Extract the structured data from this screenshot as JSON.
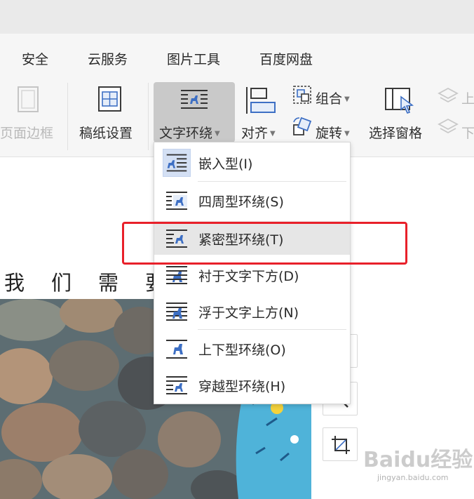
{
  "tabs": [
    "安全",
    "云服务",
    "图片工具",
    "百度网盘"
  ],
  "ribbon": {
    "page_border": "页面边框",
    "grid_setting": "稿纸设置",
    "text_wrap": "文字环绕",
    "align": "对齐",
    "group": "组合",
    "rotate": "旋转",
    "selection_pane": "选择窗格",
    "bring_forward": "上",
    "send_backward": "下"
  },
  "menu": {
    "items": [
      {
        "label": "嵌入型(I)",
        "icon": "inline-wrap-icon"
      },
      {
        "label": "四周型环绕(S)",
        "icon": "square-wrap-icon"
      },
      {
        "label": "紧密型环绕(T)",
        "icon": "tight-wrap-icon"
      },
      {
        "label": "衬于文字下方(D)",
        "icon": "behind-text-icon"
      },
      {
        "label": "浮于文字上方(N)",
        "icon": "in-front-text-icon"
      },
      {
        "label": "上下型环绕(O)",
        "icon": "top-bottom-wrap-icon"
      },
      {
        "label": "穿越型环绕(H)",
        "icon": "through-wrap-icon"
      }
    ],
    "selected_index": 2
  },
  "document": {
    "text_chars": [
      "我",
      "们",
      "需",
      "要"
    ]
  },
  "watermark": {
    "text": "Baidu经验",
    "sub": "jingyan.baidu.com"
  },
  "colors": {
    "accent": "#3d6fc4",
    "highlight_box": "#e8202a",
    "selected_bg": "#e6e6e6"
  }
}
